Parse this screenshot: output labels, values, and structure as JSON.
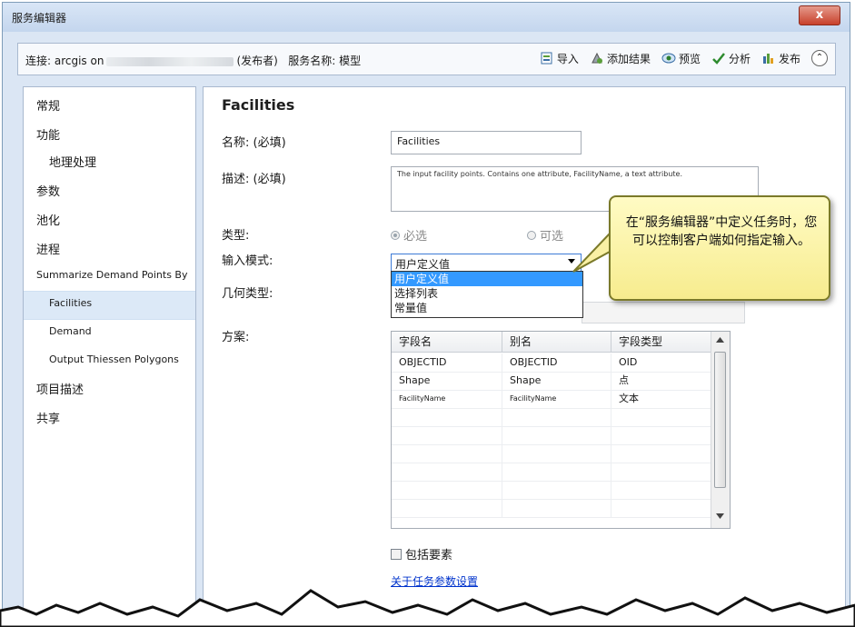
{
  "window": {
    "title": "服务编辑器",
    "close_label": "x"
  },
  "toolbar": {
    "connection_prefix": "连接: arcgis on",
    "connection_suffix": "(发布者)",
    "service_name": "服务名称: 模型",
    "import_label": "导入",
    "add_result_label": "添加结果",
    "preview_label": "预览",
    "analyze_label": "分析",
    "publish_label": "发布",
    "collapse_label": "⌃"
  },
  "sidebar": {
    "items": [
      {
        "label": "常规"
      },
      {
        "label": "功能"
      },
      {
        "label": "地理处理"
      },
      {
        "label": "参数"
      },
      {
        "label": "池化"
      },
      {
        "label": "进程"
      },
      {
        "label": "Summarize Demand Points By"
      },
      {
        "label": "Facilities"
      },
      {
        "label": "Demand"
      },
      {
        "label": "Output Thiessen Polygons"
      },
      {
        "label": "项目描述"
      },
      {
        "label": "共享"
      }
    ],
    "selected": "Facilities"
  },
  "main": {
    "heading": "Facilities",
    "name_label": "名称: (必填)",
    "name_value": "Facilities",
    "desc_label": "描述: (必填)",
    "desc_value": "The input facility points.  Contains one attribute, FacilityName, a text attribute.",
    "type_label": "类型:",
    "type_required": "必选",
    "type_optional": "可选",
    "input_mode_label": "输入模式:",
    "input_mode_value": "用户定义值",
    "input_mode_options": [
      "用户定义值",
      "选择列表",
      "常量值"
    ],
    "geometry_label": "几何类型:",
    "schema_label": "方案:",
    "grid": {
      "headers": [
        "字段名",
        "别名",
        "字段类型"
      ],
      "rows": [
        [
          "OBJECTID",
          "OBJECTID",
          "OID"
        ],
        [
          "Shape",
          "Shape",
          "点"
        ],
        [
          "FacilityName",
          "FacilityName",
          "文本"
        ]
      ]
    },
    "include_features_label": "包括要素",
    "help_link": "关于任务参数设置"
  },
  "callout": {
    "text": "在“服务编辑器”中定义任务时，您可以控制客户端如何指定输入。"
  }
}
